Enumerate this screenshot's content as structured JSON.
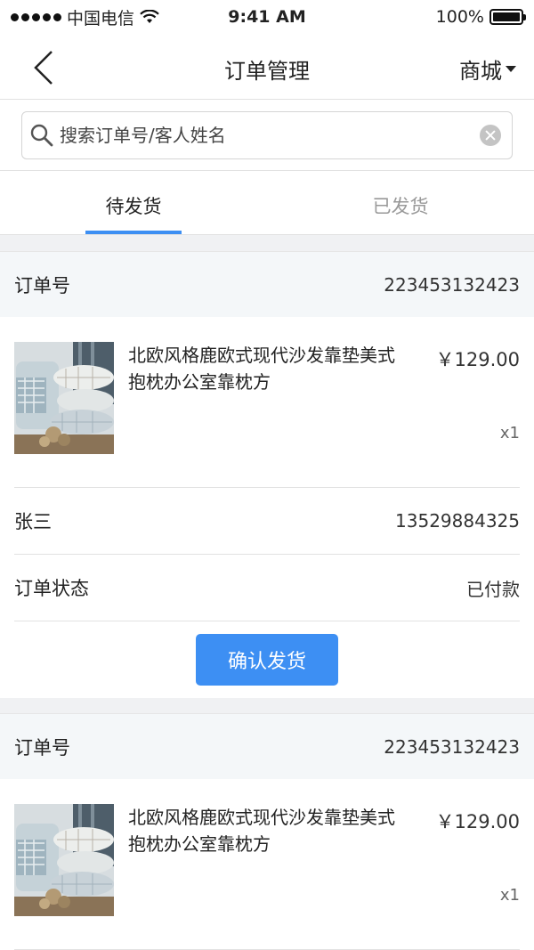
{
  "status_bar": {
    "carrier": "中国电信",
    "time": "9:41 AM",
    "battery": "100%"
  },
  "nav": {
    "title": "订单管理",
    "right_label": "商城"
  },
  "search": {
    "placeholder": "搜索订单号/客人姓名"
  },
  "tabs": [
    {
      "label": "待发货",
      "active": true
    },
    {
      "label": "已发货",
      "active": false
    }
  ],
  "orders": [
    {
      "order_label": "订单号",
      "order_no": "223453132423",
      "product_name": "北欧风格鹿欧式现代沙发靠垫美式抱枕办公室靠枕方",
      "price": "￥129.00",
      "qty": "x1",
      "customer_name": "张三",
      "phone": "13529884325",
      "status_label": "订单状态",
      "status_value": "已付款",
      "button_label": "确认发货"
    },
    {
      "order_label": "订单号",
      "order_no": "223453132423",
      "product_name": "北欧风格鹿欧式现代沙发靠垫美式抱枕办公室靠枕方",
      "price": "￥129.00",
      "qty": "x1"
    }
  ],
  "colors": {
    "accent": "#3d8ff3",
    "header_bg": "#f4f7f9",
    "page_bg": "#f0f1f3"
  }
}
